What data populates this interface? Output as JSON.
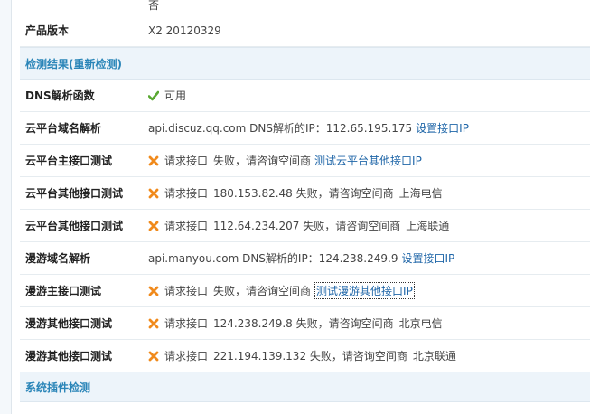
{
  "rows_top": [
    {
      "label": "",
      "value": "否"
    },
    {
      "label": "产品版本",
      "value": "X2 20120329"
    }
  ],
  "sections": {
    "detect": {
      "title": "检测结果(重新检测)"
    },
    "plugins": {
      "title": "系统插件检测"
    }
  },
  "checks": [
    {
      "label": "DNS解析函数",
      "icon": "check-icon",
      "parts": [
        "可用"
      ],
      "link": ""
    },
    {
      "label": "云平台域名解析",
      "icon": "",
      "parts": [
        "api.discuz.qq.com DNS解析的IP：112.65.195.175"
      ],
      "link": "设置接口IP"
    },
    {
      "label": "云平台主接口测试",
      "icon": "cross-icon",
      "parts": [
        "请求接口",
        "失败，请咨询空间商"
      ],
      "link": "测试云平台其他接口IP"
    },
    {
      "label": "云平台其他接口测试",
      "icon": "cross-icon",
      "parts": [
        "请求接口",
        "180.153.82.48 失败，请咨询空间商",
        "上海电信"
      ],
      "link": ""
    },
    {
      "label": "云平台其他接口测试",
      "icon": "cross-icon",
      "parts": [
        "请求接口",
        "112.64.234.207 失败，请咨询空间商",
        "上海联通"
      ],
      "link": ""
    },
    {
      "label": "漫游域名解析",
      "icon": "",
      "parts": [
        "api.manyou.com DNS解析的IP：124.238.249.9"
      ],
      "link": "设置接口IP"
    },
    {
      "label": "漫游主接口测试",
      "icon": "cross-icon",
      "parts": [
        "请求接口",
        "失败，请咨询空间商"
      ],
      "link": "测试漫游其他接口IP"
    },
    {
      "label": "漫游其他接口测试",
      "icon": "cross-icon",
      "parts": [
        "请求接口",
        "124.238.249.8 失败，请咨询空间商",
        "北京电信"
      ],
      "link": ""
    },
    {
      "label": "漫游其他接口测试",
      "icon": "cross-icon",
      "parts": [
        "请求接口",
        "221.194.139.132 失败，请咨询空间商",
        "北京联通"
      ],
      "link": ""
    }
  ],
  "colors": {
    "check": "#5aa832",
    "cross": "#f08a1c",
    "link": "#1f66a8",
    "section_title": "#2a85b8"
  }
}
